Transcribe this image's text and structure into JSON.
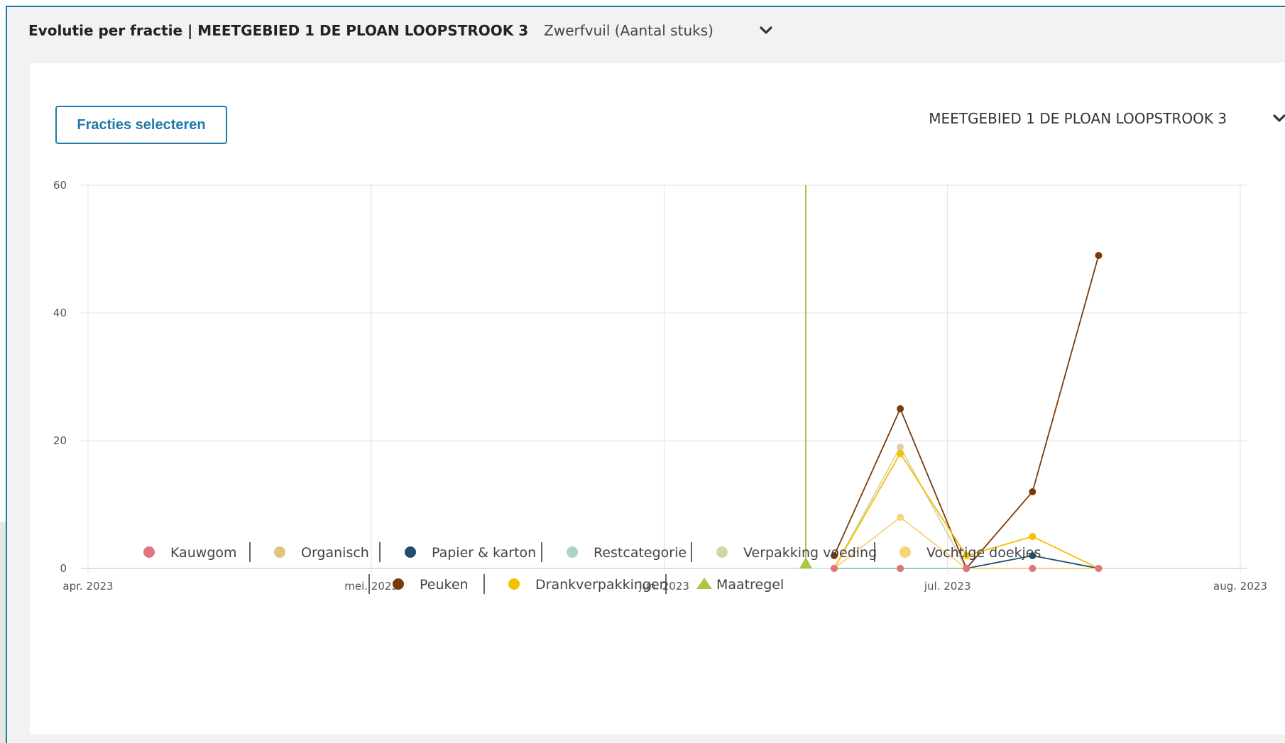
{
  "header": {
    "title": "Evolutie per fractie | MEETGEBIED 1 DE PLOAN LOOPSTROOK 3",
    "subtitle": "Zwerfvuil (Aantal stuks)"
  },
  "controls": {
    "select_fractions_label": "Fracties selecteren",
    "area_label": "MEETGEBIED 1 DE PLOAN LOOPSTROOK 3"
  },
  "icons": {
    "dropdown": "chevron-down-icon"
  },
  "chart_data": {
    "type": "line",
    "title": "",
    "xlabel": "",
    "ylabel": "",
    "xlim": [
      "2023-04-01",
      "2023-08-01"
    ],
    "ylim": [
      0,
      60
    ],
    "yticks": [
      0,
      20,
      40,
      60
    ],
    "xticks": [
      {
        "date": "2023-04-01",
        "label": "apr. 2023"
      },
      {
        "date": "2023-05-01",
        "label": "mei. 2023"
      },
      {
        "date": "2023-06-01",
        "label": "jun. 2023"
      },
      {
        "date": "2023-07-01",
        "label": "jul. 2023"
      },
      {
        "date": "2023-08-01",
        "label": "aug. 2023"
      }
    ],
    "grid": true,
    "legend_position": "bottom",
    "x": [
      "2023-06-19",
      "2023-06-26",
      "2023-07-03",
      "2023-07-10",
      "2023-07-17"
    ],
    "series": [
      {
        "name": "Kauwgom",
        "color": "#e07580",
        "values": [
          0,
          0,
          0,
          0,
          0
        ]
      },
      {
        "name": "Organisch",
        "color": "#e0c47a",
        "values": [
          0,
          0,
          0,
          0,
          0
        ]
      },
      {
        "name": "Papier & karton",
        "color": "#1f4e6e",
        "values": [
          0,
          0,
          0,
          2,
          0
        ]
      },
      {
        "name": "Restcategorie",
        "color": "#a8d5c8",
        "values": [
          0,
          0,
          0,
          0,
          0
        ]
      },
      {
        "name": "Verpakking voeding",
        "color": "#d4d4a8",
        "values": [
          0,
          19,
          0,
          0,
          0
        ]
      },
      {
        "name": "Vochtige doekjes",
        "color": "#f7d47a",
        "values": [
          0,
          8,
          0,
          0,
          0
        ]
      },
      {
        "name": "Peuken",
        "color": "#7a3a0a",
        "values": [
          2,
          25,
          0,
          12,
          49
        ]
      },
      {
        "name": "Drankverpakkingen",
        "color": "#f5c000",
        "values": [
          0,
          18,
          2,
          5,
          0
        ]
      }
    ],
    "measure": {
      "name": "Maatregel",
      "color": "#a8c840",
      "date": "2023-06-16"
    }
  }
}
